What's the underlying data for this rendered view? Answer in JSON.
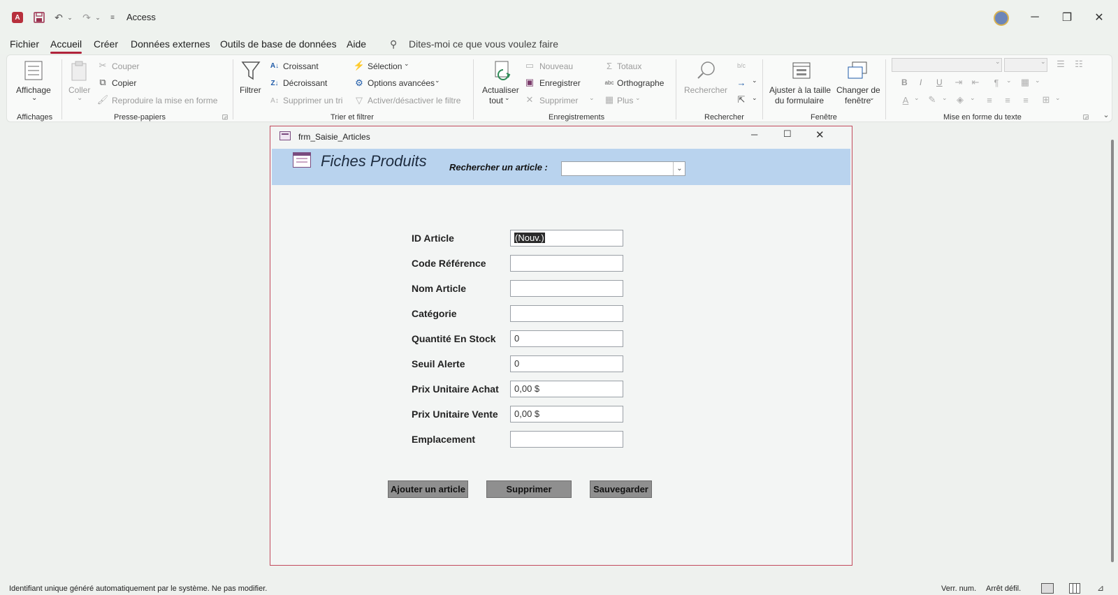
{
  "titlebar": {
    "app_title": "Access"
  },
  "menu": [
    "Fichier",
    "Accueil",
    "Créer",
    "Données externes",
    "Outils de base de données",
    "Aide"
  ],
  "tell_me": "Dites-moi ce que vous voulez faire",
  "ribbon": {
    "affichages": {
      "view": "Affichage",
      "group": "Affichages"
    },
    "presse": {
      "paste": "Coller",
      "cut": "Couper",
      "copy": "Copier",
      "format_painter": "Reproduire la mise en forme",
      "group": "Presse-papiers"
    },
    "trier": {
      "filter": "Filtrer",
      "asc": "Croissant",
      "desc": "Décroissant",
      "remove_sort": "Supprimer un tri",
      "selection": "Sélection",
      "advanced": "Options avancées",
      "toggle_filter": "Activer/désactiver le filtre",
      "group": "Trier et filtrer"
    },
    "enreg": {
      "refresh_line1": "Actualiser",
      "refresh_line2": "tout",
      "new": "Nouveau",
      "save": "Enregistrer",
      "delete": "Supprimer",
      "totals": "Totaux",
      "spelling": "Orthographe",
      "more": "Plus",
      "group": "Enregistrements"
    },
    "rechercher": {
      "find": "Rechercher",
      "group": "Rechercher"
    },
    "fenetre": {
      "fit_line1": "Ajuster à la taille",
      "fit_line2": "du formulaire",
      "switch_line1": "Changer de",
      "switch_line2": "fenêtre",
      "group": "Fenêtre"
    },
    "texte": {
      "bold": "B",
      "italic": "I",
      "underline": "U",
      "group": "Mise en forme du texte"
    }
  },
  "form": {
    "window_title": "frm_Saisie_Articles",
    "header_title": "Fiches Produits",
    "search_label": "Rechercher un article :",
    "search_value": "",
    "fields": [
      {
        "label": "ID Article",
        "value": "(Nouv.)"
      },
      {
        "label": "Code Référence",
        "value": ""
      },
      {
        "label": "Nom Article",
        "value": ""
      },
      {
        "label": "Catégorie",
        "value": ""
      },
      {
        "label": "Quantité En Stock",
        "value": "0"
      },
      {
        "label": "Seuil Alerte",
        "value": "0"
      },
      {
        "label": "Prix Unitaire Achat",
        "value": "0,00 $"
      },
      {
        "label": "Prix Unitaire Vente",
        "value": "0,00 $"
      },
      {
        "label": "Emplacement",
        "value": ""
      }
    ],
    "buttons": {
      "add": "Ajouter un article",
      "delete": "Supprimer",
      "save": "Sauvegarder"
    }
  },
  "statusbar": {
    "message": "Identifiant unique généré automatiquement par le système. Ne pas modifier.",
    "num_lock": "Verr. num.",
    "scroll_lock": "Arrêt défil."
  }
}
